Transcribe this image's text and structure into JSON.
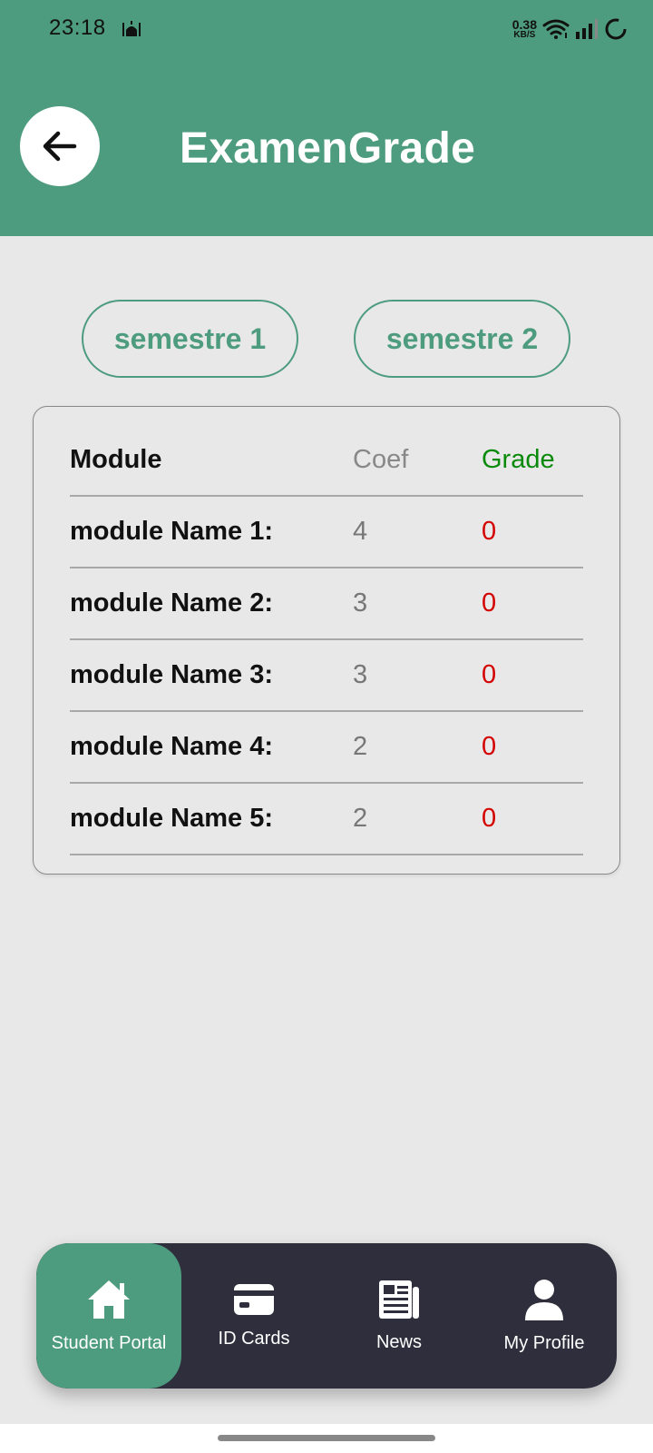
{
  "status_bar": {
    "time": "23:18",
    "net_speed_value": "0.38",
    "net_speed_unit": "KB/S"
  },
  "header": {
    "title": "ExamenGrade",
    "bg_color": "#4e9c7f"
  },
  "semesters": {
    "tab1_label": "semestre 1",
    "tab2_label": "semestre 2"
  },
  "table": {
    "headers": {
      "module": "Module",
      "coef": "Coef",
      "grade": "Grade"
    },
    "rows": [
      {
        "module": "module Name 1:",
        "coef": "4",
        "grade": "0"
      },
      {
        "module": "module Name 2:",
        "coef": "3",
        "grade": "0"
      },
      {
        "module": "module Name 3:",
        "coef": "3",
        "grade": "0"
      },
      {
        "module": "module Name 4:",
        "coef": "2",
        "grade": "0"
      },
      {
        "module": "module Name 5:",
        "coef": "2",
        "grade": "0"
      }
    ]
  },
  "bottom_nav": {
    "items": [
      {
        "label": "Student Portal",
        "icon": "home-icon",
        "active": true
      },
      {
        "label": "ID Cards",
        "icon": "card-icon",
        "active": false
      },
      {
        "label": "News",
        "icon": "newspaper-icon",
        "active": false
      },
      {
        "label": "My Profile",
        "icon": "person-icon",
        "active": false
      }
    ]
  },
  "colors": {
    "accent": "#4e9c7f",
    "grade_header": "#0a8a0a",
    "grade_value": "#d40000",
    "nav_bg": "#2e2e3c"
  }
}
